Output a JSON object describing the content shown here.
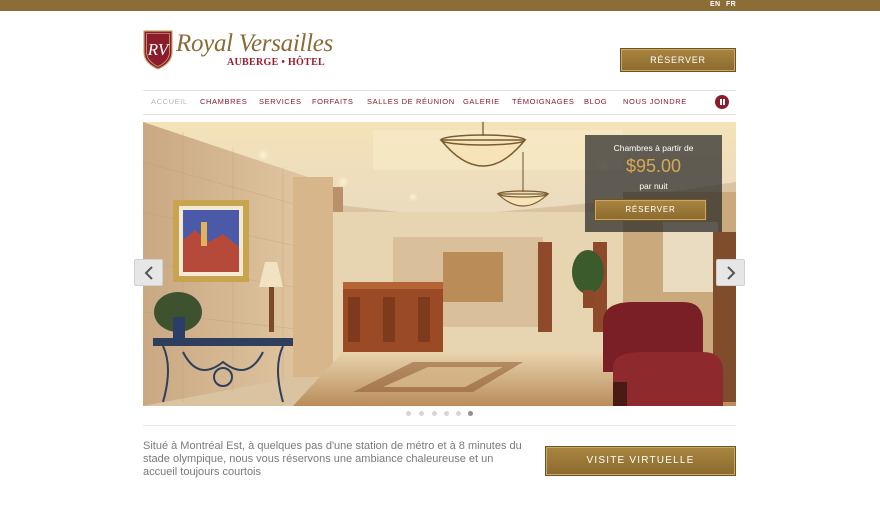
{
  "languages": {
    "en": "EN",
    "fr": "FR"
  },
  "brand": {
    "name": "Royal Versailles",
    "subtitle": "AUBERGE • HÔTEL",
    "monogram": "RV",
    "gold": "#8c6d38",
    "burgundy": "#8a1c2b"
  },
  "header": {
    "reserve_label": "RÉSERVER"
  },
  "nav": {
    "items": [
      {
        "label": "ACCUEIL",
        "active": true
      },
      {
        "label": "CHAMBRES"
      },
      {
        "label": "SERVICES"
      },
      {
        "label": "FORFAITS"
      },
      {
        "label": "SALLES DE RÉUNION"
      },
      {
        "label": "GALERIE"
      },
      {
        "label": "TÉMOIGNAGES"
      },
      {
        "label": "BLOG"
      },
      {
        "label": "NOUS JOINDRE"
      }
    ],
    "pause_icon": "pause-icon"
  },
  "slider": {
    "promo": {
      "title": "Chambres à partir de",
      "price": "$95.00",
      "per": "par nuit",
      "button": "RÉSERVER"
    },
    "prev_icon": "chevron-left-icon",
    "next_icon": "chevron-right-icon",
    "slide_count": 6,
    "active_slide": 6
  },
  "intro": {
    "text": "Situé à Montréal Est, à quelques pas d'une station de métro et à 8 minutes du stade olympique, nous vous réservons une ambiance chaleureuse et un accueil toujours courtois"
  },
  "virtual_tour": {
    "label": "VISITE VIRTUELLE"
  }
}
